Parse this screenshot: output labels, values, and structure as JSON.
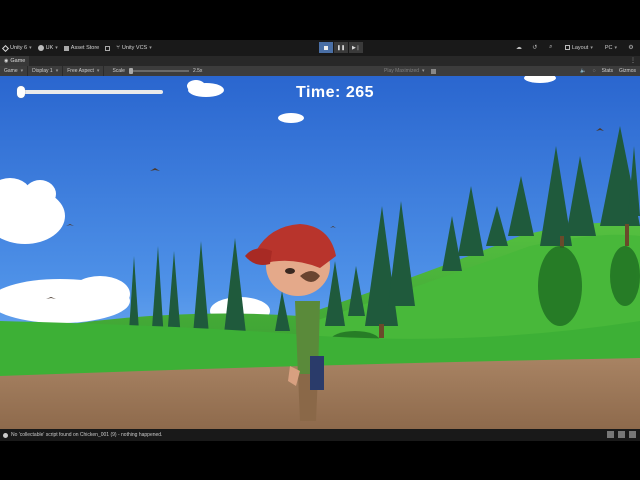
{
  "toolbar": {
    "account_label": "Unity 6",
    "user_label": "UK",
    "asset_store_label": "Asset Store",
    "vcs_label": "Unity VCS",
    "layout_label": "Layout",
    "platform_label": "PC",
    "icons": [
      "unity-logo-icon",
      "account-icon",
      "store-icon",
      "package-icon",
      "vcs-icon",
      "play-icon",
      "pause-icon",
      "step-icon",
      "cloud-icon",
      "history-icon",
      "search-icon",
      "layout-icon",
      "settings-icon"
    ]
  },
  "tab": {
    "label": "Game"
  },
  "gamebar": {
    "mode": "Game",
    "display": "Display 1",
    "aspect": "Free Aspect",
    "scale_label": "Scale",
    "scale_value": "2.5x",
    "play_mode": "Play Maximized",
    "stats_label": "Stats",
    "gizmos_label": "Gizmos"
  },
  "hud": {
    "timer_text": "Time: 265",
    "slider_value": 0
  },
  "console": {
    "message": "No 'collectable' script found on Chicken_001 (9) - nothing happened."
  },
  "colors": {
    "sky_top": "#2f6fd6",
    "sky_bottom": "#6aa8f0",
    "grass": "#3aa335",
    "dirt": "#a07a58",
    "toolbar_bg": "#191919"
  }
}
